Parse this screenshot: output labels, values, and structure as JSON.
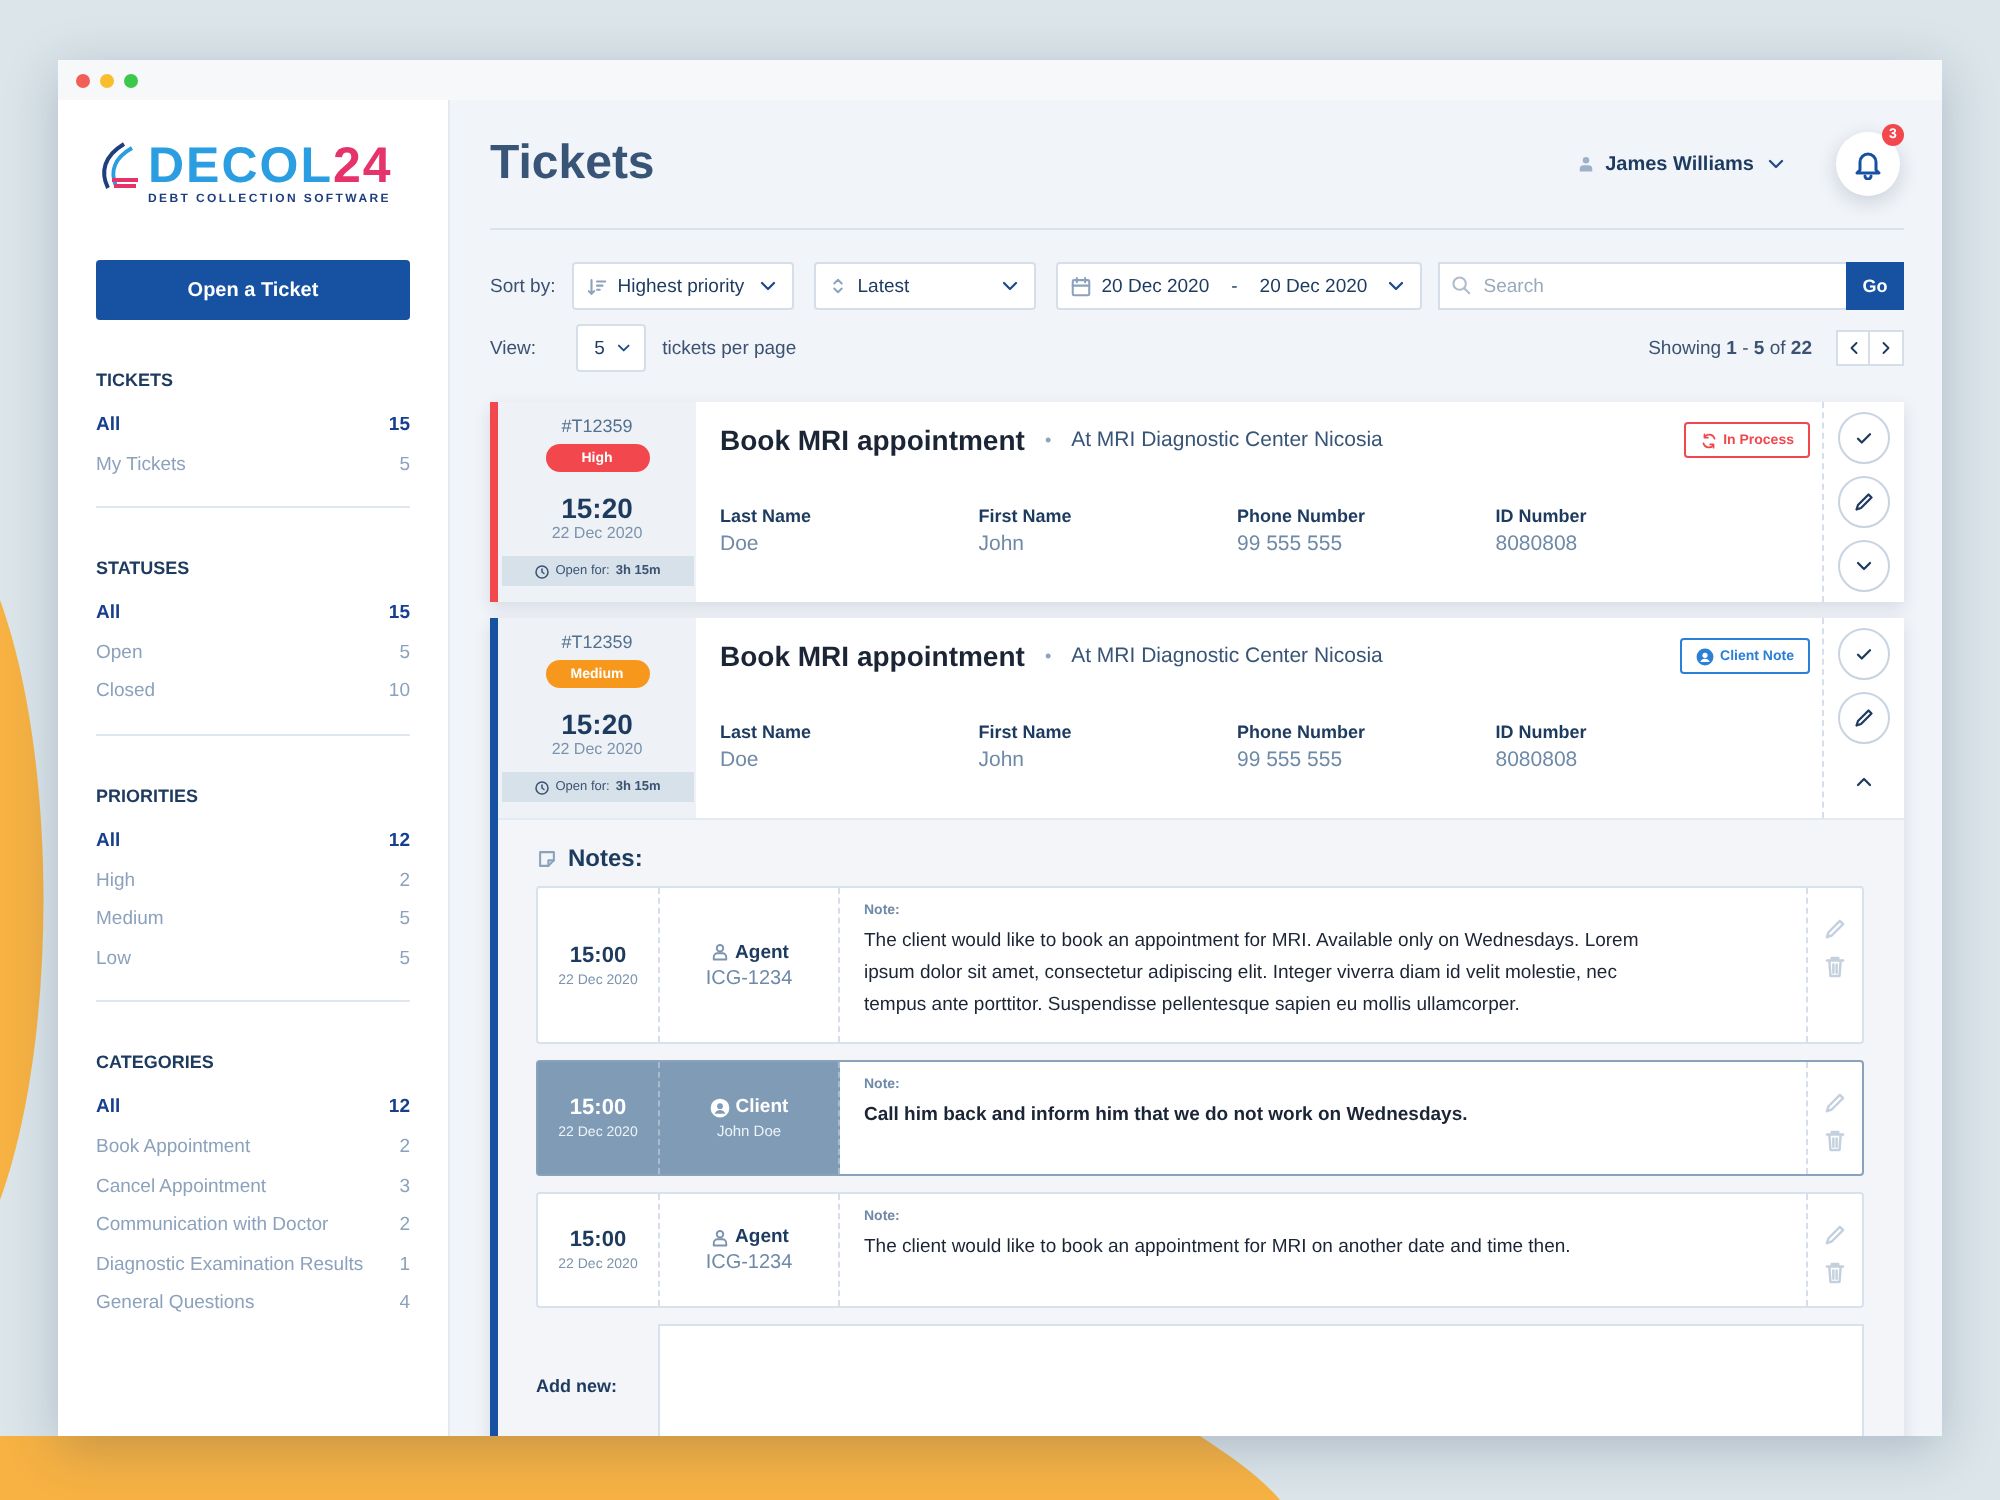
{
  "logo": {
    "name": "DECOL",
    "number": "24",
    "tagline": "DEBT COLLECTION SOFTWARE"
  },
  "sidebar": {
    "open_button": "Open a Ticket",
    "sections": [
      {
        "title": "TICKETS",
        "items": [
          {
            "label": "All",
            "count": "15",
            "selected": true
          },
          {
            "label": "My Tickets",
            "count": "5",
            "selected": false
          }
        ]
      },
      {
        "title": "STATUSES",
        "items": [
          {
            "label": "All",
            "count": "15",
            "selected": true
          },
          {
            "label": "Open",
            "count": "5",
            "selected": false
          },
          {
            "label": "Closed",
            "count": "10",
            "selected": false
          }
        ]
      },
      {
        "title": "PRIORITIES",
        "items": [
          {
            "label": "All",
            "count": "12",
            "selected": true
          },
          {
            "label": "High",
            "count": "2",
            "selected": false
          },
          {
            "label": "Medium",
            "count": "5",
            "selected": false
          },
          {
            "label": "Low",
            "count": "5",
            "selected": false
          }
        ]
      },
      {
        "title": "CATEGORIES",
        "items": [
          {
            "label": "All",
            "count": "12",
            "selected": true
          },
          {
            "label": "Book Appointment",
            "count": "2",
            "selected": false
          },
          {
            "label": "Cancel Appointment",
            "count": "3",
            "selected": false
          },
          {
            "label": "Communication with Doctor",
            "count": "2",
            "selected": false
          },
          {
            "label": "Diagnostic Examination Results",
            "count": "1",
            "selected": false
          },
          {
            "label": "General Questions",
            "count": "4",
            "selected": false
          }
        ]
      }
    ]
  },
  "header": {
    "title": "Tickets",
    "user": "James Williams",
    "notifications": "3"
  },
  "filters": {
    "sort_label": "Sort by:",
    "sort": "Highest priority",
    "order": "Latest",
    "date_from": "20 Dec 2020",
    "date_separator": "-",
    "date_to": "20 Dec 2020",
    "search_placeholder": "Search",
    "search_button": "Go",
    "view_label": "View:",
    "per_page": "5",
    "per_page_suffix": "tickets per page",
    "showing": "Showing **1** - **5** of **22**"
  },
  "tickets": [
    {
      "id": "#T12359",
      "priority": {
        "label": "High",
        "color": "#f2474d"
      },
      "time": "15:20",
      "date": "22 Dec 2020",
      "open_for_label": "Open for:",
      "open_for": "3h 15m",
      "title": "Book MRI appointment",
      "separator": "•",
      "location": "At MRI Diagnostic Center Nicosia",
      "status": {
        "kind": "in_process",
        "label": "In Process"
      },
      "expanded": false,
      "fields": [
        {
          "label": "Last Name",
          "value": "Doe"
        },
        {
          "label": "First Name",
          "value": "John"
        },
        {
          "label": "Phone Number",
          "value": "99 555 555"
        },
        {
          "label": "ID Number",
          "value": "8080808"
        }
      ]
    },
    {
      "id": "#T12359",
      "priority": {
        "label": "Medium",
        "color": "#f7981d"
      },
      "time": "15:20",
      "date": "22 Dec 2020",
      "open_for_label": "Open for:",
      "open_for": "3h 15m",
      "title": "Book MRI appointment",
      "separator": "•",
      "location": "At MRI Diagnostic Center Nicosia",
      "status": {
        "kind": "client_note",
        "label": "Client Note"
      },
      "expanded": true,
      "fields": [
        {
          "label": "Last Name",
          "value": "Doe"
        },
        {
          "label": "First Name",
          "value": "John"
        },
        {
          "label": "Phone Number",
          "value": "99 555 555"
        },
        {
          "label": "ID Number",
          "value": "8080808"
        }
      ],
      "notes": {
        "title": "Notes:",
        "add_label": "Add new:",
        "items": [
          {
            "time": "15:00",
            "date": "22 Dec 2020",
            "kind": "staff",
            "role": "Agent",
            "who": "ICG-1234",
            "label": "Note:",
            "text": "The client would like to book an appointment for MRI. Available only on Wednesdays. Lorem ipsum dolor sit amet, consectetur adipiscing elit. Integer viverra diam id velit molestie, nec tempus ante porttitor. Suspendisse pellentesque sapien eu mollis ullamcorper.",
            "selected": false
          },
          {
            "time": "15:00",
            "date": "22 Dec 2020",
            "kind": "customer",
            "role": "Client",
            "who": "John Doe",
            "label": "Note:",
            "text": "Call him back and inform him that we do not work on Wednesdays.",
            "selected": true
          },
          {
            "time": "15:00",
            "date": "22 Dec 2020",
            "kind": "staff",
            "role": "Agent",
            "who": "ICG-1234",
            "label": "Note:",
            "text": "The client would like to book an appointment for MRI on another date and time then.",
            "selected": false
          }
        ]
      }
    }
  ]
}
